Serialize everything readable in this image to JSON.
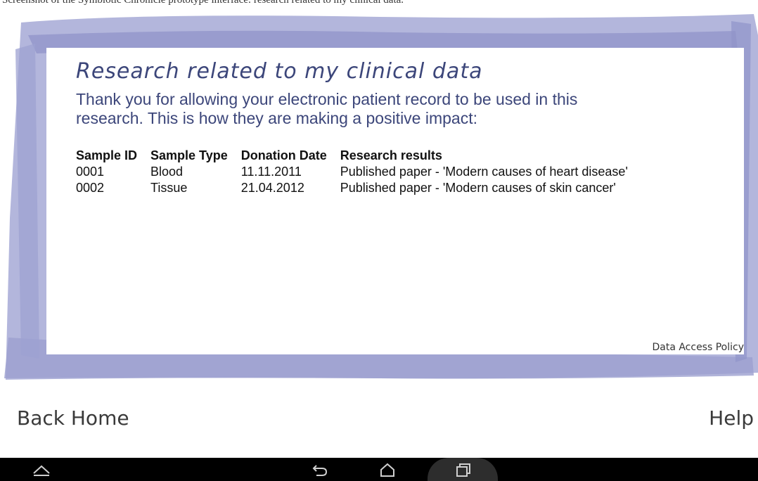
{
  "caption": "Screenshot of the Symbiotic Chronicle prototype interface: research related to my clinical data.",
  "content": {
    "heading": "Research related to my clinical data",
    "intro": "Thank you for allowing your electronic patient record to be used in this\nresearch. This is how they are making a positive impact:",
    "table": {
      "headers": [
        "Sample ID",
        "Sample Type",
        "Donation Date",
        "Research results"
      ],
      "rows": [
        [
          "0001",
          "Blood",
          "11.11.2011",
          "Published paper - 'Modern causes of heart disease'"
        ],
        [
          "0002",
          "Tissue",
          "21.04.2012",
          "Published paper - 'Modern causes of skin cancer'"
        ]
      ]
    },
    "policy_link": "Data Access Policy"
  },
  "nav": {
    "back_home": "Back Home",
    "help": "Help"
  },
  "system_bar": {
    "icons": [
      "expand-up-icon",
      "back-icon",
      "home-icon",
      "recent-apps-icon"
    ]
  },
  "colors": {
    "frame": "#a6a9d6",
    "frame_dark": "#8e92c8",
    "heading_text": "#3c467a",
    "system_bar": "#000000"
  }
}
